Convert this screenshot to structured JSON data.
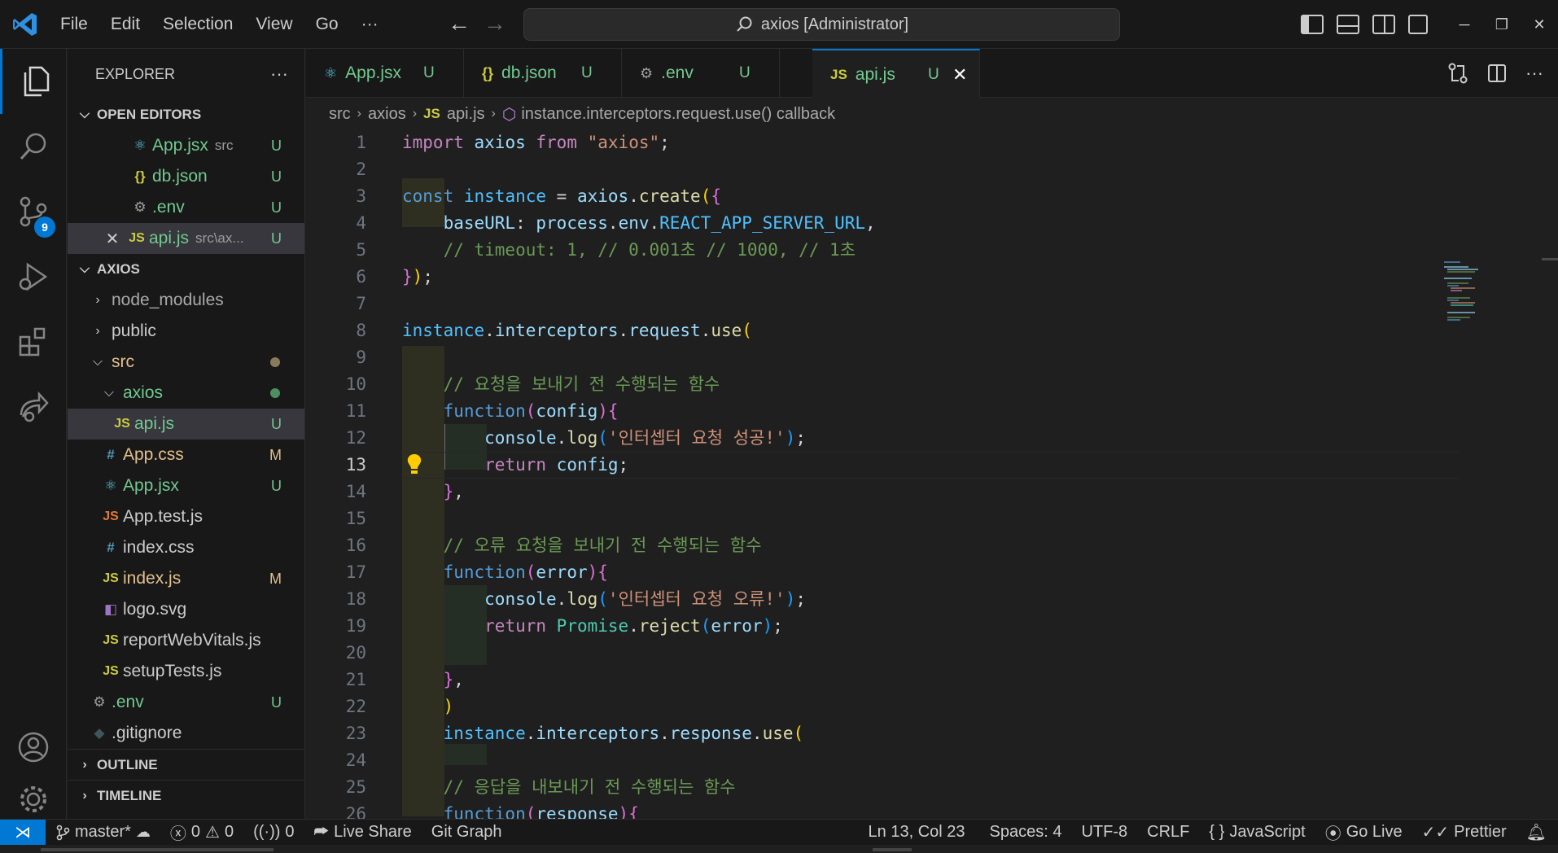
{
  "menu": [
    "File",
    "Edit",
    "Selection",
    "View",
    "Go",
    "···"
  ],
  "search": {
    "text": "axios [Administrator]"
  },
  "activity_bar": {
    "scm_badge": "9"
  },
  "explorer": {
    "title": "EXPLORER",
    "more": "···",
    "open_editors_title": "OPEN EDITORS",
    "open_editors": [
      {
        "icon": "react-icon",
        "name": "App.jsx",
        "desc": "src",
        "status": "U"
      },
      {
        "icon": "json-icon",
        "name": "db.json",
        "desc": "",
        "status": "U"
      },
      {
        "icon": "gear-icon",
        "name": ".env",
        "desc": "",
        "status": "U"
      },
      {
        "icon": "js-icon",
        "name": "api.js",
        "desc": "src\\ax...",
        "status": "U"
      }
    ],
    "project_title": "AXIOS",
    "tree": [
      {
        "name": "node_modules",
        "status": ""
      },
      {
        "name": "public",
        "status": ""
      },
      {
        "name": "src",
        "status": ""
      },
      {
        "name": "axios",
        "status": ""
      },
      {
        "name": "api.js",
        "status": "U"
      },
      {
        "name": "App.css",
        "status": "M"
      },
      {
        "name": "App.jsx",
        "status": "U"
      },
      {
        "name": "App.test.js",
        "status": ""
      },
      {
        "name": "index.css",
        "status": ""
      },
      {
        "name": "index.js",
        "status": "M"
      },
      {
        "name": "logo.svg",
        "status": ""
      },
      {
        "name": "reportWebVitals.js",
        "status": ""
      },
      {
        "name": "setupTests.js",
        "status": ""
      },
      {
        "name": ".env",
        "status": "U"
      },
      {
        "name": ".gitignore",
        "status": ""
      }
    ],
    "outline_title": "OUTLINE",
    "timeline_title": "TIMELINE"
  },
  "tabs": [
    {
      "icon": "⚛",
      "label": "App.jsx",
      "status": "U"
    },
    {
      "icon": "{}",
      "label": "db.json",
      "status": "U"
    },
    {
      "icon": "⚙",
      "label": ".env",
      "status": "U"
    },
    {
      "icon": "JS",
      "label": "api.js",
      "status": "U",
      "close": "✕"
    }
  ],
  "breadcrumb": [
    "src",
    "axios",
    "JS",
    "api.js",
    "instance.interceptors.request.use() callback"
  ],
  "editor": {
    "line_numbers": [
      "1",
      "2",
      "3",
      "4",
      "5",
      "6",
      "7",
      "8",
      "9",
      "10",
      "11",
      "12",
      "13",
      "14",
      "15",
      "16",
      "17",
      "18",
      "19",
      "20",
      "21",
      "22",
      "23",
      "24",
      "25",
      "26"
    ],
    "current_line": "13"
  },
  "status": {
    "branch": "master*",
    "errors": "0",
    "warnings": "0",
    "ports": "0",
    "live_share": "Live Share",
    "git_graph": "Git Graph",
    "position": "Ln 13, Col 23",
    "spaces": "Spaces: 4",
    "encoding": "UTF-8",
    "eol": "CRLF",
    "language": "JavaScript",
    "go_live": "Go Live",
    "prettier": "Prettier"
  },
  "colors": {
    "accent": "#0078d4",
    "untracked": "#73c991",
    "modified": "#e2c08d"
  }
}
